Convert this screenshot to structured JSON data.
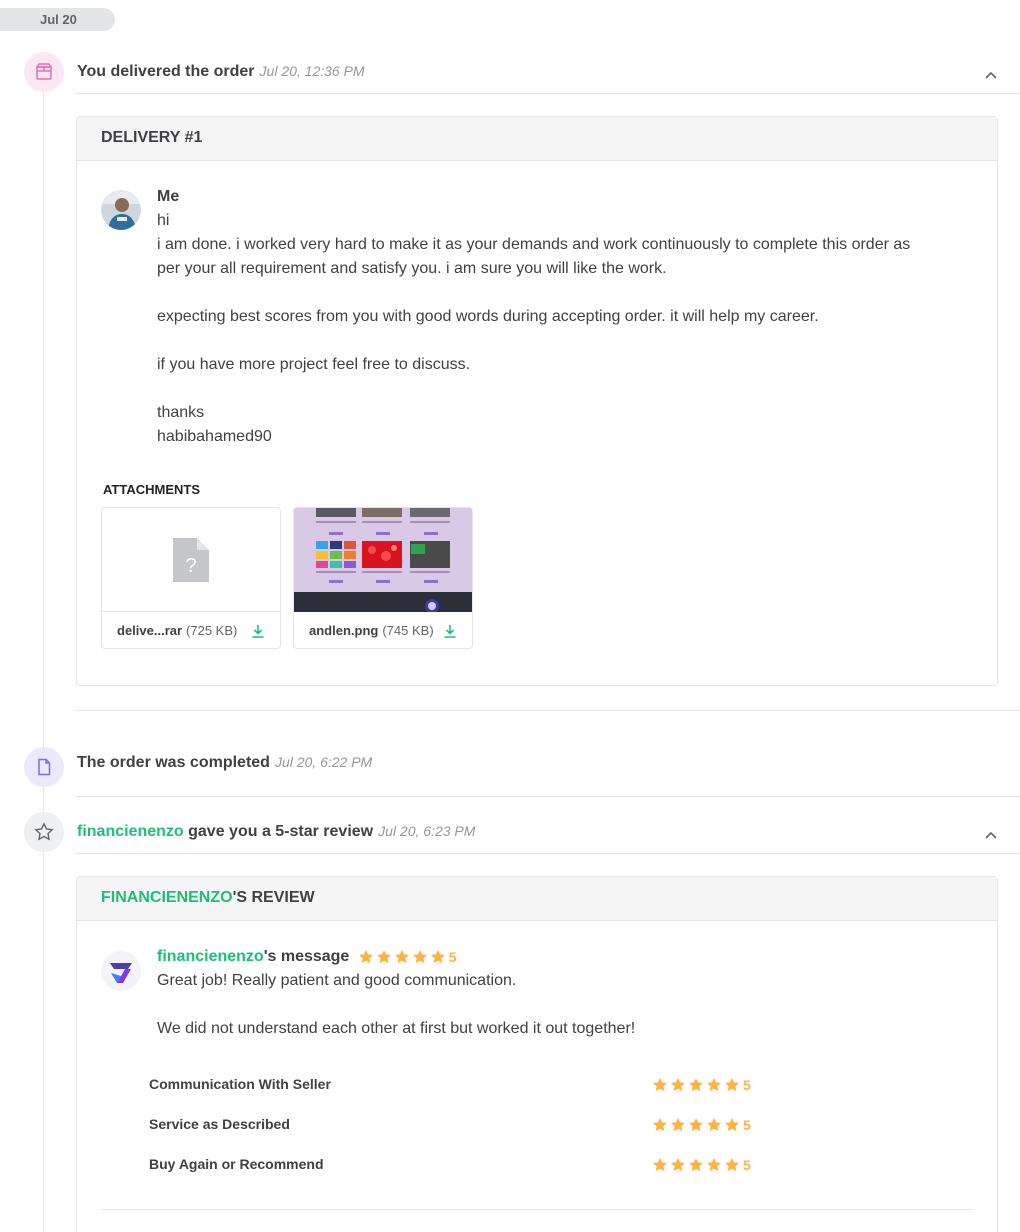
{
  "date_pill": "Jul 20",
  "events": {
    "delivered": {
      "title": "You delivered the order",
      "time": "Jul 20, 12:36 PM",
      "icon": "package-icon"
    },
    "completed": {
      "title": "The order was completed",
      "time": "Jul 20, 6:22 PM",
      "icon": "document-icon"
    },
    "review": {
      "user": "financienenzo",
      "title_rest": " gave you a 5-star review",
      "time": "Jul 20, 6:23 PM",
      "icon": "star-icon"
    }
  },
  "delivery": {
    "header": "DELIVERY #1",
    "sender": "Me",
    "message_lines": [
      "hi",
      "i am done. i worked very hard to make it as your demands and work continuously to complete this order as per your all requirement and satisfy you. i am sure you will like the work.",
      "",
      "expecting best scores from you with good words during accepting order. it will help my career.",
      "",
      "if you have more project feel free to discuss.",
      "",
      "thanks",
      "habibahamed90"
    ],
    "attachments_label": "ATTACHMENTS",
    "attachments": [
      {
        "name": "delive...rar",
        "size": "(725 KB)",
        "type": "unknown-file"
      },
      {
        "name": "andlen.png",
        "size": "(745 KB)",
        "type": "image"
      }
    ]
  },
  "review": {
    "header_user": "FINANCIENENZO",
    "header_rest": "'S REVIEW",
    "message_user": "financienenzo",
    "message_suffix": "'s message",
    "rating": 5,
    "rating_text": "5",
    "message_lines": [
      "Great job! Really patient and good communication.",
      "",
      "We did not understand each other at first but worked it out together!"
    ],
    "criteria": [
      {
        "label": "Communication With Seller",
        "rating": 5,
        "rating_text": "5"
      },
      {
        "label": "Service as Described",
        "rating": 5,
        "rating_text": "5"
      },
      {
        "label": "Buy Again or Recommend",
        "rating": 5,
        "rating_text": "5"
      }
    ]
  },
  "colors": {
    "accent_green": "#1dbf73",
    "star_orange": "#ffb33e",
    "text": "#404145"
  }
}
